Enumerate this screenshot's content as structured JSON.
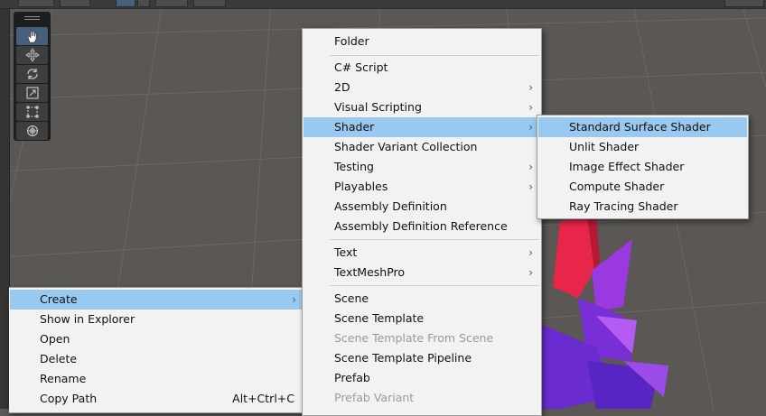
{
  "colors": {
    "scene_bg": "#5a5754",
    "grid_line": "#6b6864",
    "menu_bg": "#f2f2f2",
    "highlight": "#99c9ef",
    "disabled_text": "#9a9a9a",
    "tool_selected": "#46607c"
  },
  "tools": [
    {
      "name": "hand-tool",
      "icon": "hand-icon",
      "selected": true
    },
    {
      "name": "move-tool",
      "icon": "move-icon",
      "selected": false
    },
    {
      "name": "rotate-tool",
      "icon": "rotate-icon",
      "selected": false
    },
    {
      "name": "scale-tool",
      "icon": "scale-icon",
      "selected": false
    },
    {
      "name": "rect-tool",
      "icon": "rect-transform-icon",
      "selected": false
    },
    {
      "name": "transform-tool",
      "icon": "transform-icon",
      "selected": false
    }
  ],
  "context_menu": {
    "items": [
      {
        "label": "Create",
        "submenu": true,
        "highlighted": true
      },
      {
        "label": "Show in Explorer"
      },
      {
        "label": "Open"
      },
      {
        "label": "Delete"
      },
      {
        "label": "Rename"
      },
      {
        "label": "Copy Path",
        "shortcut": "Alt+Ctrl+C"
      }
    ]
  },
  "create_menu": {
    "items": [
      {
        "label": "Folder"
      },
      {
        "label": "C# Script"
      },
      {
        "label": "2D",
        "submenu": true
      },
      {
        "label": "Visual Scripting",
        "submenu": true
      },
      {
        "label": "Shader",
        "submenu": true,
        "highlighted": true
      },
      {
        "label": "Shader Variant Collection"
      },
      {
        "label": "Testing",
        "submenu": true
      },
      {
        "label": "Playables",
        "submenu": true
      },
      {
        "label": "Assembly Definition"
      },
      {
        "label": "Assembly Definition Reference"
      },
      {
        "label": "Text",
        "submenu": true
      },
      {
        "label": "TextMeshPro",
        "submenu": true
      },
      {
        "label": "Scene"
      },
      {
        "label": "Scene Template"
      },
      {
        "label": "Scene Template From Scene",
        "disabled": true
      },
      {
        "label": "Scene Template Pipeline"
      },
      {
        "label": "Prefab"
      },
      {
        "label": "Prefab Variant",
        "disabled": true
      }
    ]
  },
  "shader_menu": {
    "items": [
      {
        "label": "Standard Surface Shader",
        "highlighted": true
      },
      {
        "label": "Unlit Shader"
      },
      {
        "label": "Image Effect Shader"
      },
      {
        "label": "Compute Shader"
      },
      {
        "label": "Ray Tracing Shader"
      }
    ]
  },
  "arrow_glyph": "›"
}
